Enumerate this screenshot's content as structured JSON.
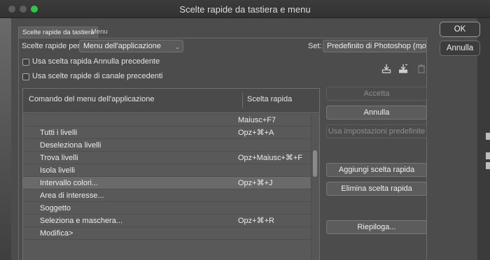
{
  "window": {
    "title": "Scelte rapide da tastiera e menu"
  },
  "tabs": [
    {
      "label": "Scelte rapide da tastiera",
      "active": true
    },
    {
      "label": "Menu",
      "active": false
    }
  ],
  "shortcuts_for": {
    "label": "Scelte rapide per:",
    "value": "Menu dell'applicazione"
  },
  "set": {
    "label": "Set:",
    "value": "Predefinito di Photoshop (mo..."
  },
  "options": {
    "undo": {
      "label": "Usa scelta rapida Annulla precedente",
      "checked": false
    },
    "channel": {
      "label": "Usa scelte rapide di canale precedenti",
      "checked": false
    }
  },
  "toolbar_icons": [
    "save-set-icon",
    "new-set-icon",
    "trash-icon"
  ],
  "table": {
    "headers": {
      "command": "Comando del menu dell'applicazione",
      "shortcut": "Scelta rapida"
    },
    "rows": [
      {
        "command": "",
        "shortcut": "Maiusc+F7",
        "selected": false
      },
      {
        "command": "Tutti i livelli",
        "shortcut": "Opz+⌘+A",
        "selected": false
      },
      {
        "command": "Deseleziona livelli",
        "shortcut": "",
        "selected": false
      },
      {
        "command": "Trova livelli",
        "shortcut": "Opz+Maiusc+⌘+F",
        "selected": false
      },
      {
        "command": "Isola livelli",
        "shortcut": "",
        "selected": false
      },
      {
        "command": "Intervallo colori...",
        "shortcut": "Opz+⌘+J",
        "selected": true
      },
      {
        "command": "Area di interesse...",
        "shortcut": "",
        "selected": false
      },
      {
        "command": "Soggetto",
        "shortcut": "",
        "selected": false
      },
      {
        "command": "Seleziona e maschera...",
        "shortcut": "Opz+⌘+R",
        "selected": false
      },
      {
        "command": "Modifica>",
        "shortcut": "",
        "selected": false
      }
    ]
  },
  "side_buttons": {
    "accept": "Accetta",
    "cancel": "Annulla",
    "defaults": "Usa impostazioni predefinite",
    "add": "Aggiungi scelta rapida",
    "remove": "Elimina scelta rapida",
    "summary": "Riepiloga..."
  },
  "dialog_buttons": {
    "ok": "OK",
    "cancel": "Annulla"
  }
}
